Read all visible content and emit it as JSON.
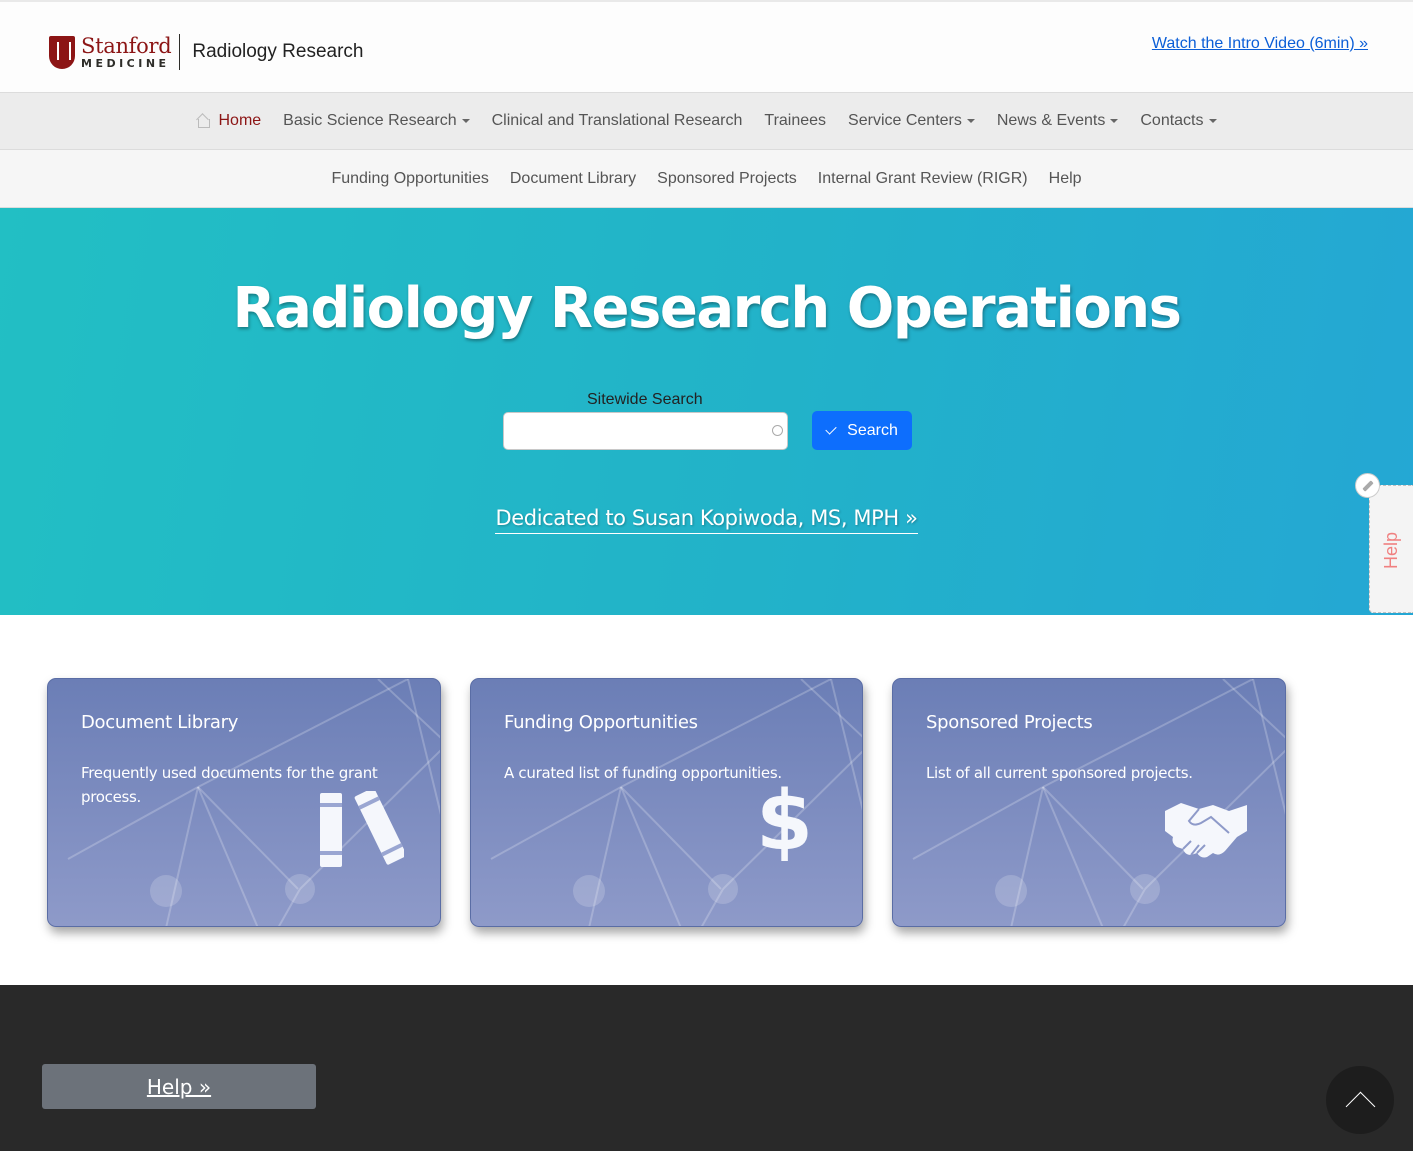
{
  "header": {
    "logo_stanford": "Stanford",
    "logo_medicine": "MEDICINE",
    "site_name": "Radiology Research",
    "intro_link": "Watch the Intro Video (6min) »"
  },
  "nav_primary": [
    {
      "label": "Home",
      "active": true,
      "icon": "home-icon"
    },
    {
      "label": "Basic Science Research",
      "dropdown": true
    },
    {
      "label": "Clinical and Translational Research"
    },
    {
      "label": "Trainees"
    },
    {
      "label": "Service Centers",
      "dropdown": true
    },
    {
      "label": "News & Events",
      "dropdown": true
    },
    {
      "label": "Contacts",
      "dropdown": true
    }
  ],
  "nav_secondary": [
    {
      "label": "Funding Opportunities"
    },
    {
      "label": "Document Library"
    },
    {
      "label": "Sponsored Projects"
    },
    {
      "label": "Internal Grant Review (RIGR)"
    },
    {
      "label": "Help"
    }
  ],
  "hero": {
    "title": "Radiology Research Operations",
    "search_label": "Sitewide Search",
    "search_value": "",
    "search_button": "Search",
    "dedication": "Dedicated to Susan Kopiwoda, MS, MPH »"
  },
  "side_help": {
    "label": "Help"
  },
  "cards": [
    {
      "title": "Document Library",
      "description": "Frequently used documents for the grant process.",
      "icon": "books-icon"
    },
    {
      "title": "Funding Opportunities",
      "description": "A curated list of funding opportunities.",
      "icon": "dollar-icon"
    },
    {
      "title": "Sponsored Projects",
      "description": "List of all current sponsored projects.",
      "icon": "handshake-icon"
    }
  ],
  "footer": {
    "help_link": "Help »"
  },
  "colors": {
    "brand": "#8c1515",
    "link": "#0b5ed7",
    "button": "#0d6efd",
    "footer": "#292929"
  }
}
